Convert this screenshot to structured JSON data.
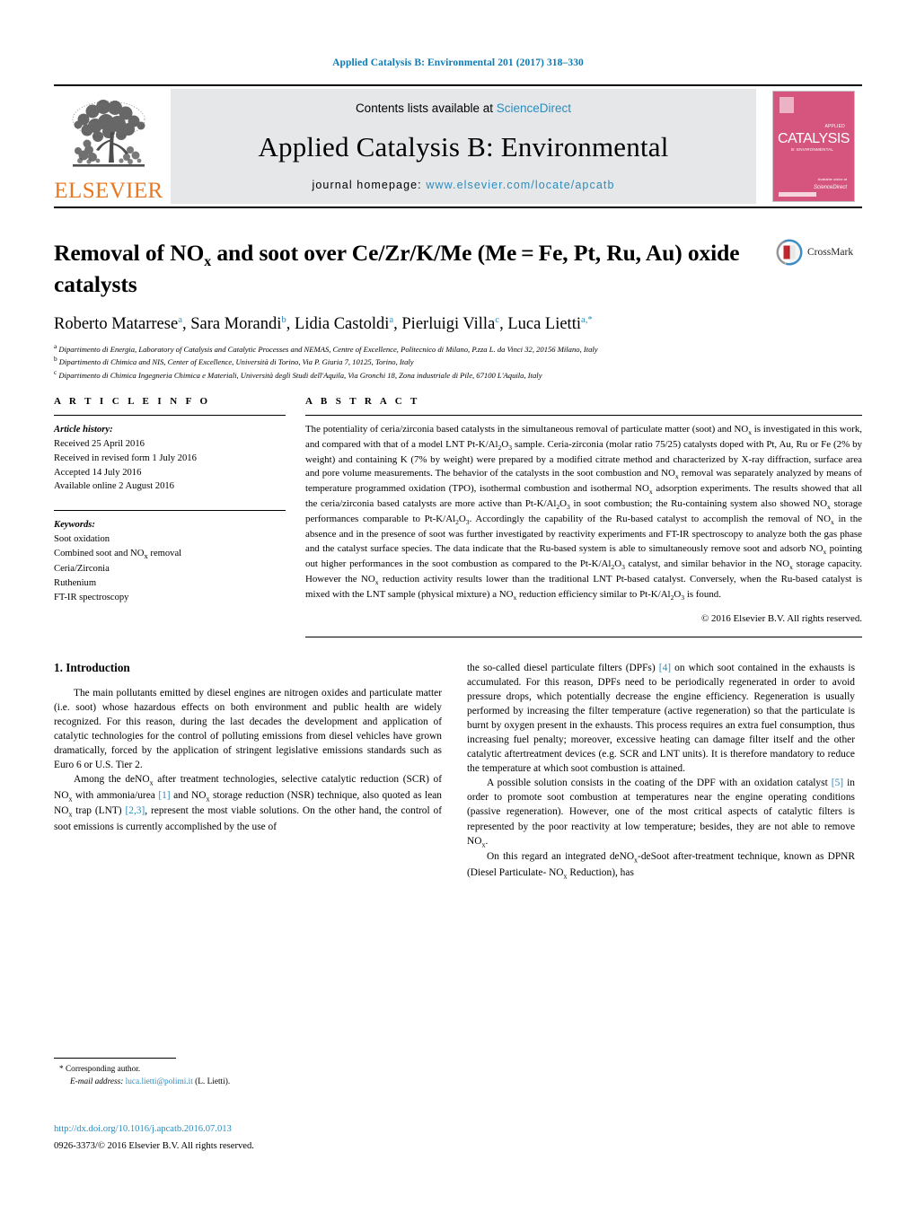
{
  "running_head": "Applied Catalysis B: Environmental 201 (2017) 318–330",
  "masthead": {
    "publisher_logo_text": "ELSEVIER",
    "contents_prefix": "Contents lists available at ",
    "contents_link": "ScienceDirect",
    "journal_title": "Applied Catalysis B: Environmental",
    "homepage_label": "journal homepage: ",
    "homepage_url": "www.elsevier.com/locate/apcatb",
    "cover": {
      "title": "CATALYSIS",
      "applied": "APPLIED",
      "subtitle": "B: ENVIRONMENTAL",
      "footer_small": "Available online at",
      "footer_brand": "ScienceDirect",
      "background_color": "#d6557f"
    }
  },
  "article": {
    "title_part1": "Removal of NO",
    "title_sub": "x",
    "title_part2": " and soot over Ce/Zr/K/Me (Me = Fe, Pt, Ru, Au) oxide catalysts",
    "crossmark_label": "CrossMark",
    "authors": [
      {
        "name": "Roberto Matarrese",
        "sup": "a"
      },
      {
        "name": "Sara Morandi",
        "sup": "b"
      },
      {
        "name": "Lidia Castoldi",
        "sup": "a"
      },
      {
        "name": "Pierluigi Villa",
        "sup": "c"
      },
      {
        "name": "Luca Lietti",
        "sup": "a,*"
      }
    ],
    "affiliations": [
      {
        "marker": "a",
        "text": "Dipartimento di Energia, Laboratory of Catalysis and Catalytic Processes and NEMAS, Centre of Excellence, Politecnico di Milano, P.zza L. da Vinci 32, 20156 Milano, Italy"
      },
      {
        "marker": "b",
        "text": "Dipartimento di Chimica and NIS, Center of Excellence, Università di Torino, Via P. Giuria 7, 10125, Torino, Italy"
      },
      {
        "marker": "c",
        "text": "Dipartimento di Chimica Ingegneria Chimica e Materiali, Università degli Studi dell'Aquila, Via Gronchi 18, Zona industriale di Pile, 67100 L'Aquila, Italy"
      }
    ]
  },
  "article_info": {
    "heading": "A R T I C L E   I N F O",
    "history_label": "Article history:",
    "history": [
      "Received 25 April 2016",
      "Received in revised form 1 July 2016",
      "Accepted 14 July 2016",
      "Available online 2 August 2016"
    ],
    "keywords_label": "Keywords:",
    "keywords": [
      "Soot oxidation",
      "Combined soot and NOx removal",
      "Ceria/Zirconia",
      "Ruthenium",
      "FT-IR spectroscopy"
    ]
  },
  "abstract": {
    "heading": "A B S T R A C T",
    "text": "The potentiality of ceria/zirconia based catalysts in the simultaneous removal of particulate matter (soot) and NOx is investigated in this work, and compared with that of a model LNT Pt-K/Al2O3 sample. Ceria-zirconia (molar ratio 75/25) catalysts doped with Pt, Au, Ru or Fe (2% by weight) and containing K (7% by weight) were prepared by a modified citrate method and characterized by X-ray diffraction, surface area and pore volume measurements. The behavior of the catalysts in the soot combustion and NOx removal was separately analyzed by means of temperature programmed oxidation (TPO), isothermal combustion and isothermal NOx adsorption experiments. The results showed that all the ceria/zirconia based catalysts are more active than Pt-K/Al2O3 in soot combustion; the Ru-containing system also showed NOx storage performances comparable to Pt-K/Al2O3. Accordingly the capability of the Ru-based catalyst to accomplish the removal of NOx in the absence and in the presence of soot was further investigated by reactivity experiments and FT-IR spectroscopy to analyze both the gas phase and the catalyst surface species. The data indicate that the Ru-based system is able to simultaneously remove soot and adsorb NOx pointing out higher performances in the soot combustion as compared to the Pt-K/Al2O3 catalyst, and similar behavior in the NOx storage capacity. However the NOx reduction activity results lower than the traditional LNT Pt-based catalyst. Conversely, when the Ru-based catalyst is mixed with the LNT sample (physical mixture) a NOx reduction efficiency similar to Pt-K/Al2O3 is found.",
    "copyright": "© 2016 Elsevier B.V. All rights reserved."
  },
  "introduction": {
    "heading": "1.  Introduction",
    "left_paragraphs": [
      "The main pollutants emitted by diesel engines are nitrogen oxides and particulate matter (i.e. soot) whose hazardous effects on both environment and public health are widely recognized. For this reason, during the last decades the development and application of catalytic technologies for the control of polluting emissions from diesel vehicles have grown dramatically, forced by the application of stringent legislative emissions standards such as Euro 6 or U.S. Tier 2.",
      "Among the deNOx after treatment technologies, selective catalytic reduction (SCR) of NOx with ammonia/urea [1] and NOx storage reduction (NSR) technique, also quoted as lean NOx trap (LNT) [2,3], represent the most viable solutions. On the other hand, the control of soot emissions is currently accomplished by the use of"
    ],
    "right_paragraphs": [
      "the so-called diesel particulate filters (DPFs) [4] on which soot contained in the exhausts is accumulated. For this reason, DPFs need to be periodically regenerated in order to avoid pressure drops, which potentially decrease the engine efficiency. Regeneration is usually performed by increasing the filter temperature (active regeneration) so that the particulate is burnt by oxygen present in the exhausts. This process requires an extra fuel consumption, thus increasing fuel penalty; moreover, excessive heating can damage filter itself and the other catalytic aftertreatment devices (e.g. SCR and LNT units). It is therefore mandatory to reduce the temperature at which soot combustion is attained.",
      "A possible solution consists in the coating of the DPF with an oxidation catalyst [5] in order to promote soot combustion at temperatures near the engine operating conditions (passive regeneration). However, one of the most critical aspects of catalytic filters is represented by the poor reactivity at low temperature; besides, they are not able to remove NOx.",
      "On this regard an integrated deNOx-deSoot after-treatment technique, known as DPNR (Diesel Particulate- NOx Reduction), has"
    ]
  },
  "footer": {
    "corresponding_marker": "*",
    "corresponding_label": "Corresponding author.",
    "email_label": "E-mail address:",
    "email": "luca.lietti@polimi.it",
    "email_attrib": "(L. Lietti).",
    "doi": "http://dx.doi.org/10.1016/j.apcatb.2016.07.013",
    "issn_line": "0926-3373/© 2016 Elsevier B.V. All rights reserved."
  },
  "colors": {
    "link_blue": "#2b8cbe",
    "running_head_blue": "#0b7ab5",
    "elsevier_orange": "#E87722",
    "cover_pink": "#d6557f"
  }
}
